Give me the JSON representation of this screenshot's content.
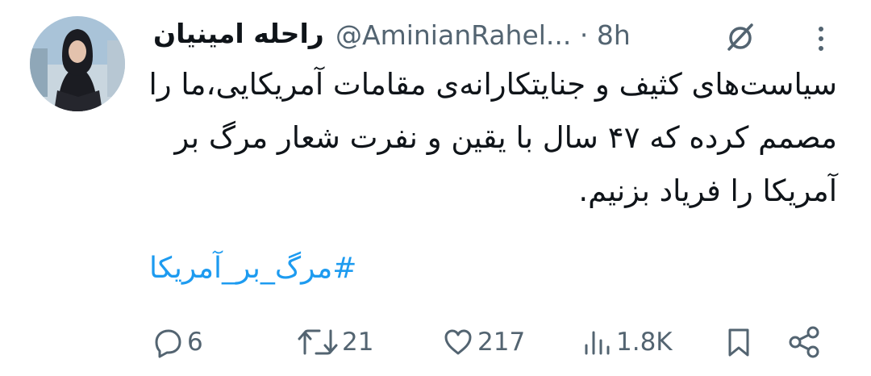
{
  "post": {
    "author_name": "راحله امینیان",
    "author_handle": "@AminianRahel...",
    "time": "· 8h",
    "text": "سیاست‌های کثیف و جنایتکارانه‌ی مقامات آمریکایی،ما را مصمم کرده که ۴۷ سال با یقین و نفرت شعار مرگ بر آمریکا را فریاد بزنیم.",
    "hashtag": "#مرگ_بر_آمریکا"
  },
  "actions": {
    "replies": "6",
    "reposts": "21",
    "likes": "217",
    "views": "1.8K"
  },
  "icons": [
    "grok-icon",
    "more-icon",
    "reply-icon",
    "repost-icon",
    "like-icon",
    "views-icon",
    "bookmark-icon",
    "share-icon"
  ],
  "colors": {
    "link": "#1d9bf0",
    "secondary_text": "#536471",
    "primary_text": "#0f1419"
  }
}
